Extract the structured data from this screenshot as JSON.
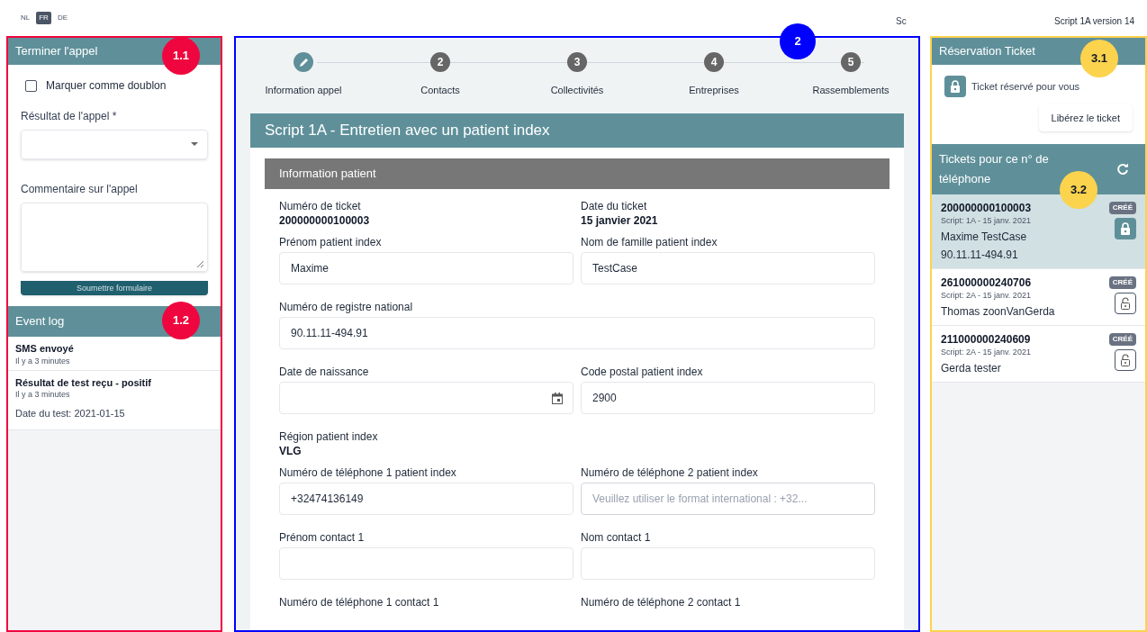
{
  "languages": [
    {
      "label": "NL",
      "selected": false
    },
    {
      "label": "FR",
      "selected": true
    },
    {
      "label": "DE",
      "selected": false
    }
  ],
  "header_cut_text": "Sc",
  "version": "Script 1A version 14",
  "annotations": [
    {
      "label": "1.1",
      "color": "#f0063e"
    },
    {
      "label": "1.2",
      "color": "#f0063e"
    },
    {
      "label": "2",
      "color": "#0000ff"
    },
    {
      "label": "3.1",
      "color": "#fcd34d"
    },
    {
      "label": "3.2",
      "color": "#fcd34d"
    }
  ],
  "end_call": {
    "title": "Terminer l'appel",
    "duplicate": {
      "label": "Marquer comme doublon",
      "checked": false
    },
    "result_label": "Résultat de l'appel *",
    "comment_label": "Commentaire sur l'appel",
    "submit": "Soumettre formulaire"
  },
  "event_log": {
    "title": "Event log",
    "events": [
      {
        "title": "SMS envoyé",
        "time": "Il y a 3 minutes"
      },
      {
        "title": "Résultat de test reçu - positif",
        "time": "Il y a 3 minutes",
        "detail": "Date du test: 2021-01-15"
      }
    ]
  },
  "steps": [
    {
      "label": "Information appel",
      "selected": true
    },
    {
      "number": "2",
      "label": "Contacts",
      "selected": false
    },
    {
      "number": "3",
      "label": "Collectivités",
      "selected": false
    },
    {
      "number": "4",
      "label": "Entreprises",
      "selected": false
    },
    {
      "number": "5",
      "label": "Rassemblements",
      "selected": false
    }
  ],
  "script_title": "Script 1A - Entretien avec un patient index",
  "section_title": "Information patient",
  "fields": [
    {
      "kind": "static",
      "label": "Numéro de ticket",
      "value": "200000000100003"
    },
    {
      "kind": "static",
      "label": "Date du ticket",
      "value": "15 janvier 2021"
    },
    {
      "kind": "input",
      "label": "Prénom patient index",
      "value": "Maxime"
    },
    {
      "kind": "input",
      "label": "Nom de famille patient index",
      "value": "TestCase"
    },
    {
      "kind": "input",
      "label": "Numéro de registre national",
      "value": "90.11.11-494.91",
      "wide": true
    },
    {
      "kind": "date",
      "label": "Date de naissance"
    },
    {
      "kind": "input",
      "label": "Code postal patient index",
      "value": "2900"
    },
    {
      "kind": "static",
      "label": "Région patient index",
      "value": "VLG",
      "wide": true
    },
    {
      "kind": "input",
      "label": "Numéro de téléphone 1 patient index",
      "value": "+32474136149"
    },
    {
      "kind": "input",
      "label": "Numéro de téléphone 2 patient index",
      "placeholder": "Veuillez utiliser le format international : +32..."
    },
    {
      "kind": "input",
      "label": "Prénom contact 1"
    },
    {
      "kind": "input",
      "label": "Nom contact 1"
    },
    {
      "kind": "static",
      "label": "Numéro de téléphone 1 contact 1"
    },
    {
      "kind": "static",
      "label": "Numéro de téléphone 2 contact 1"
    }
  ],
  "reservation": {
    "title": "Réservation Ticket",
    "status": "Ticket réservé pour vous",
    "release": "Libérez le ticket"
  },
  "tickets": {
    "title": "Tickets pour ce n° de téléphone",
    "items": [
      {
        "number": "200000000100003",
        "meta": "Script: 1A - 15 janv. 2021",
        "name": "Maxime TestCase",
        "national_id": "90.11.11-494.91",
        "status": "CRÉÉ",
        "selected": true,
        "locked": true
      },
      {
        "number": "261000000240706",
        "meta": "Script: 2A - 15 janv. 2021",
        "name": "Thomas zoonVanGerda",
        "status": "CRÉÉ",
        "selected": false,
        "locked": false
      },
      {
        "number": "211000000240609",
        "meta": "Script: 2A - 15 janv. 2021",
        "name": "Gerda tester",
        "status": "CRÉÉ",
        "selected": false,
        "locked": false
      }
    ]
  }
}
